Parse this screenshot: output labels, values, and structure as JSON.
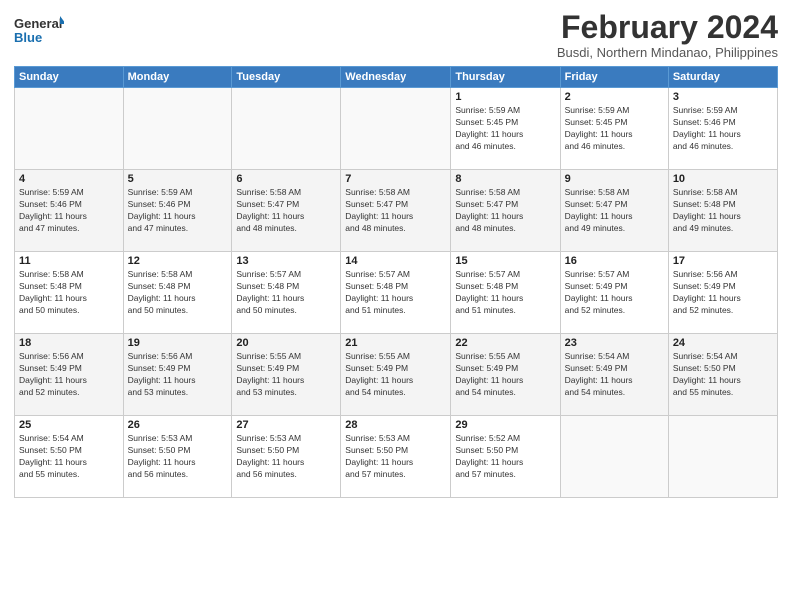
{
  "logo": {
    "line1": "General",
    "line2": "Blue"
  },
  "header": {
    "month": "February 2024",
    "location": "Busdi, Northern Mindanao, Philippines"
  },
  "weekdays": [
    "Sunday",
    "Monday",
    "Tuesday",
    "Wednesday",
    "Thursday",
    "Friday",
    "Saturday"
  ],
  "weeks": [
    [
      {
        "day": "",
        "info": ""
      },
      {
        "day": "",
        "info": ""
      },
      {
        "day": "",
        "info": ""
      },
      {
        "day": "",
        "info": ""
      },
      {
        "day": "1",
        "info": "Sunrise: 5:59 AM\nSunset: 5:45 PM\nDaylight: 11 hours\nand 46 minutes."
      },
      {
        "day": "2",
        "info": "Sunrise: 5:59 AM\nSunset: 5:45 PM\nDaylight: 11 hours\nand 46 minutes."
      },
      {
        "day": "3",
        "info": "Sunrise: 5:59 AM\nSunset: 5:46 PM\nDaylight: 11 hours\nand 46 minutes."
      }
    ],
    [
      {
        "day": "4",
        "info": "Sunrise: 5:59 AM\nSunset: 5:46 PM\nDaylight: 11 hours\nand 47 minutes."
      },
      {
        "day": "5",
        "info": "Sunrise: 5:59 AM\nSunset: 5:46 PM\nDaylight: 11 hours\nand 47 minutes."
      },
      {
        "day": "6",
        "info": "Sunrise: 5:58 AM\nSunset: 5:47 PM\nDaylight: 11 hours\nand 48 minutes."
      },
      {
        "day": "7",
        "info": "Sunrise: 5:58 AM\nSunset: 5:47 PM\nDaylight: 11 hours\nand 48 minutes."
      },
      {
        "day": "8",
        "info": "Sunrise: 5:58 AM\nSunset: 5:47 PM\nDaylight: 11 hours\nand 48 minutes."
      },
      {
        "day": "9",
        "info": "Sunrise: 5:58 AM\nSunset: 5:47 PM\nDaylight: 11 hours\nand 49 minutes."
      },
      {
        "day": "10",
        "info": "Sunrise: 5:58 AM\nSunset: 5:48 PM\nDaylight: 11 hours\nand 49 minutes."
      }
    ],
    [
      {
        "day": "11",
        "info": "Sunrise: 5:58 AM\nSunset: 5:48 PM\nDaylight: 11 hours\nand 50 minutes."
      },
      {
        "day": "12",
        "info": "Sunrise: 5:58 AM\nSunset: 5:48 PM\nDaylight: 11 hours\nand 50 minutes."
      },
      {
        "day": "13",
        "info": "Sunrise: 5:57 AM\nSunset: 5:48 PM\nDaylight: 11 hours\nand 50 minutes."
      },
      {
        "day": "14",
        "info": "Sunrise: 5:57 AM\nSunset: 5:48 PM\nDaylight: 11 hours\nand 51 minutes."
      },
      {
        "day": "15",
        "info": "Sunrise: 5:57 AM\nSunset: 5:48 PM\nDaylight: 11 hours\nand 51 minutes."
      },
      {
        "day": "16",
        "info": "Sunrise: 5:57 AM\nSunset: 5:49 PM\nDaylight: 11 hours\nand 52 minutes."
      },
      {
        "day": "17",
        "info": "Sunrise: 5:56 AM\nSunset: 5:49 PM\nDaylight: 11 hours\nand 52 minutes."
      }
    ],
    [
      {
        "day": "18",
        "info": "Sunrise: 5:56 AM\nSunset: 5:49 PM\nDaylight: 11 hours\nand 52 minutes."
      },
      {
        "day": "19",
        "info": "Sunrise: 5:56 AM\nSunset: 5:49 PM\nDaylight: 11 hours\nand 53 minutes."
      },
      {
        "day": "20",
        "info": "Sunrise: 5:55 AM\nSunset: 5:49 PM\nDaylight: 11 hours\nand 53 minutes."
      },
      {
        "day": "21",
        "info": "Sunrise: 5:55 AM\nSunset: 5:49 PM\nDaylight: 11 hours\nand 54 minutes."
      },
      {
        "day": "22",
        "info": "Sunrise: 5:55 AM\nSunset: 5:49 PM\nDaylight: 11 hours\nand 54 minutes."
      },
      {
        "day": "23",
        "info": "Sunrise: 5:54 AM\nSunset: 5:49 PM\nDaylight: 11 hours\nand 54 minutes."
      },
      {
        "day": "24",
        "info": "Sunrise: 5:54 AM\nSunset: 5:50 PM\nDaylight: 11 hours\nand 55 minutes."
      }
    ],
    [
      {
        "day": "25",
        "info": "Sunrise: 5:54 AM\nSunset: 5:50 PM\nDaylight: 11 hours\nand 55 minutes."
      },
      {
        "day": "26",
        "info": "Sunrise: 5:53 AM\nSunset: 5:50 PM\nDaylight: 11 hours\nand 56 minutes."
      },
      {
        "day": "27",
        "info": "Sunrise: 5:53 AM\nSunset: 5:50 PM\nDaylight: 11 hours\nand 56 minutes."
      },
      {
        "day": "28",
        "info": "Sunrise: 5:53 AM\nSunset: 5:50 PM\nDaylight: 11 hours\nand 57 minutes."
      },
      {
        "day": "29",
        "info": "Sunrise: 5:52 AM\nSunset: 5:50 PM\nDaylight: 11 hours\nand 57 minutes."
      },
      {
        "day": "",
        "info": ""
      },
      {
        "day": "",
        "info": ""
      }
    ]
  ]
}
